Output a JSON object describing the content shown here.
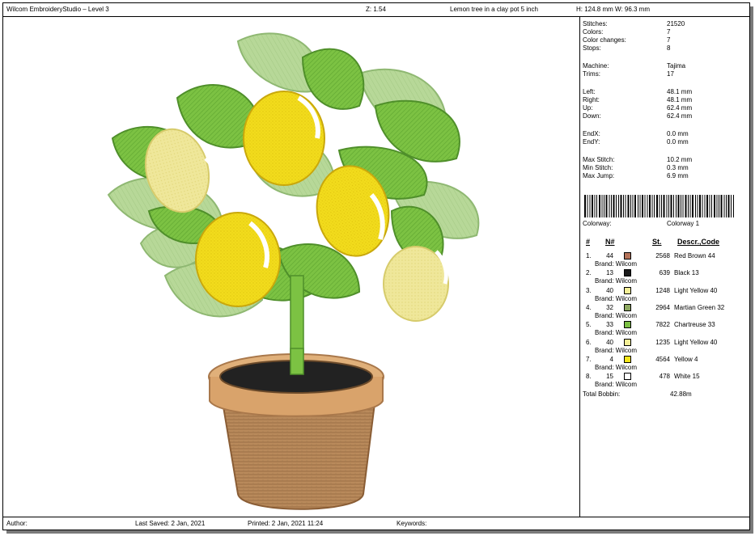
{
  "header": {
    "app_title": "Wilcom EmbroideryStudio – Level 3",
    "zoom": "Z: 1.54",
    "design_name": "Lemon tree in a clay pot 5 inch",
    "size": "H: 124.8 mm  W: 96.3 mm"
  },
  "stats": [
    {
      "label": "Stitches:",
      "value": "21520"
    },
    {
      "label": "Colors:",
      "value": "7"
    },
    {
      "label": "Color changes:",
      "value": "7"
    },
    {
      "label": "Stops:",
      "value": "8"
    },
    {
      "label": "Machine:",
      "value": "Tajima"
    },
    {
      "label": "Trims:",
      "value": "17"
    },
    {
      "label": "Left:",
      "value": "48.1 mm"
    },
    {
      "label": "Right:",
      "value": "48.1 mm"
    },
    {
      "label": "Up:",
      "value": "62.4 mm"
    },
    {
      "label": "Down:",
      "value": "62.4 mm"
    },
    {
      "label": "EndX:",
      "value": "0.0 mm"
    },
    {
      "label": "EndY:",
      "value": "0.0 mm"
    },
    {
      "label": "Max Stitch:",
      "value": "10.2 mm"
    },
    {
      "label": "Min Stitch:",
      "value": "0.3 mm"
    },
    {
      "label": "Max Jump:",
      "value": "6.9 mm"
    }
  ],
  "colorway": {
    "label": "Colorway:",
    "value": "Colorway 1"
  },
  "table_headers": {
    "num": "#",
    "code": "N#",
    "stitches": "St.",
    "descr": "Descr.,Code"
  },
  "colors": [
    {
      "idx": "1.",
      "code": "44",
      "hex": "#b5735a",
      "stitches": "2568",
      "name": "Red Brown 44",
      "brand": "Brand: Wilcom"
    },
    {
      "idx": "2.",
      "code": "13",
      "hex": "#1a1a1a",
      "stitches": "639",
      "name": "Black 13",
      "brand": "Brand: Wilcom"
    },
    {
      "idx": "3.",
      "code": "40",
      "hex": "#f4ef96",
      "stitches": "1248",
      "name": "Light Yellow 40",
      "brand": "Brand: Wilcom"
    },
    {
      "idx": "4.",
      "code": "32",
      "hex": "#8faa62",
      "stitches": "2964",
      "name": "Martian Green 32",
      "brand": "Brand: Wilcom"
    },
    {
      "idx": "5.",
      "code": "33",
      "hex": "#7bc043",
      "stitches": "7822",
      "name": "Chartreuse 33",
      "brand": "Brand: Wilcom"
    },
    {
      "idx": "6.",
      "code": "40",
      "hex": "#f4ef96",
      "stitches": "1235",
      "name": "Light Yellow 40",
      "brand": "Brand: Wilcom"
    },
    {
      "idx": "7.",
      "code": "4",
      "hex": "#f5e61a",
      "stitches": "4564",
      "name": "Yellow 4",
      "brand": "Brand: Wilcom"
    },
    {
      "idx": "8.",
      "code": "15",
      "hex": "#ffffff",
      "stitches": "478",
      "name": "White 15",
      "brand": "Brand: Wilcom"
    }
  ],
  "bobbin": {
    "label": "Total Bobbin:",
    "value": "42.88m"
  },
  "footer": {
    "author": "Author:",
    "last_saved": "Last Saved:  2 Jan, 2021",
    "printed": "Printed:  2 Jan, 2021 11:24",
    "keywords": "Keywords:"
  }
}
